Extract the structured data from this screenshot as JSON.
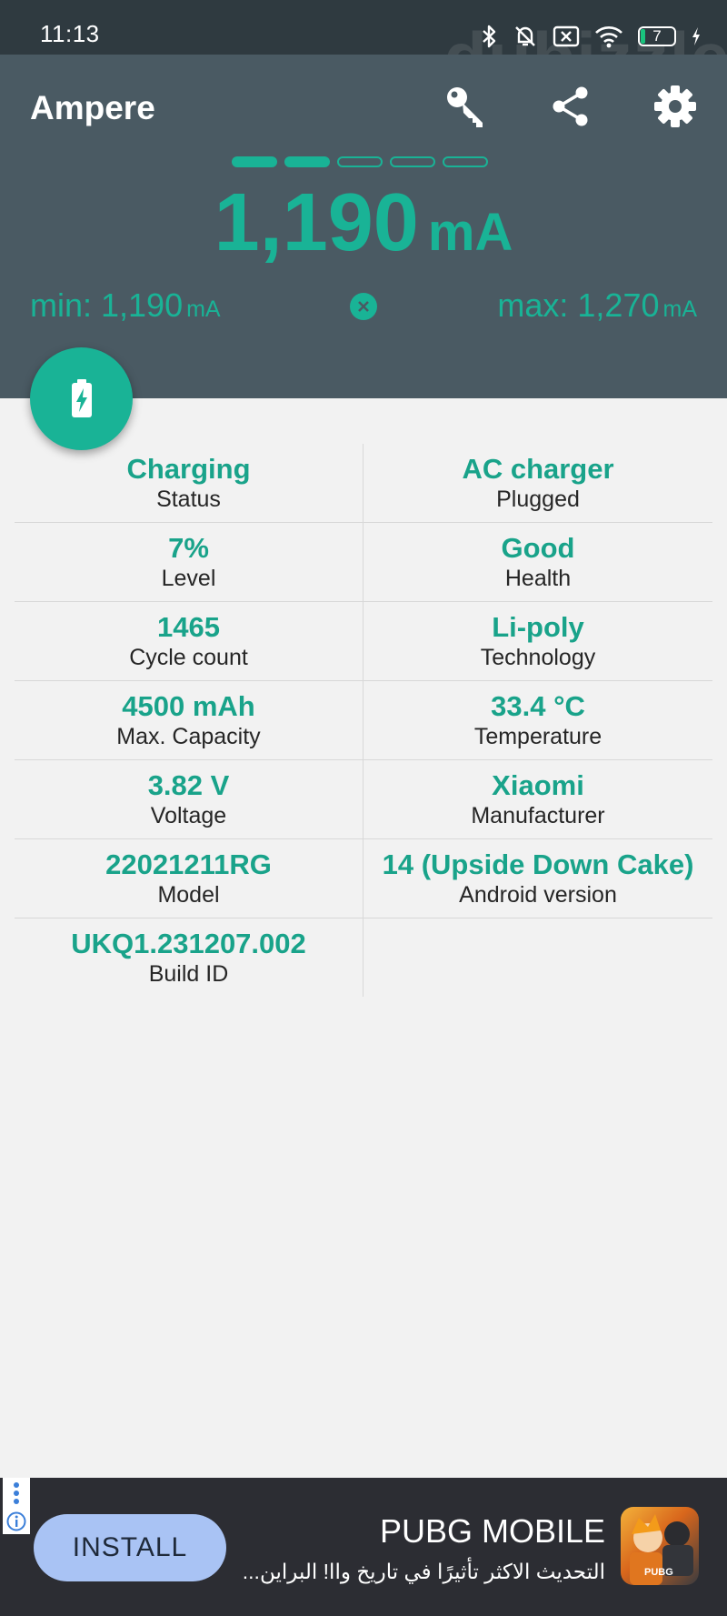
{
  "status_bar": {
    "time": "11:13",
    "battery_level": "7"
  },
  "watermark": "dubizzle",
  "app": {
    "title": "Ampere"
  },
  "meter": {
    "current_value": "1,190",
    "current_unit": "mA",
    "min_label": "min: 1,190",
    "min_unit": "mA",
    "max_label": "max: 1,270",
    "max_unit": "mA",
    "indicator_filled": 2,
    "indicator_total": 5
  },
  "info": {
    "rows": [
      [
        {
          "value": "Charging",
          "label": "Status"
        },
        {
          "value": "AC charger",
          "label": "Plugged"
        }
      ],
      [
        {
          "value": "7%",
          "label": "Level"
        },
        {
          "value": "Good",
          "label": "Health"
        }
      ],
      [
        {
          "value": "1465",
          "label": "Cycle count"
        },
        {
          "value": "Li-poly",
          "label": "Technology"
        }
      ],
      [
        {
          "value": "4500 mAh",
          "label": "Max. Capacity"
        },
        {
          "value": "33.4 °C",
          "label": "Temperature"
        }
      ],
      [
        {
          "value": "3.82 V",
          "label": "Voltage"
        },
        {
          "value": "Xiaomi",
          "label": "Manufacturer"
        }
      ],
      [
        {
          "value": "22021211RG",
          "label": "Model"
        },
        {
          "value": "14 (Upside Down Cake)",
          "label": "Android version"
        }
      ],
      [
        {
          "value": "UKQ1.231207.002",
          "label": "Build ID"
        },
        {
          "value": "",
          "label": ""
        }
      ]
    ]
  },
  "ad": {
    "install_label": "INSTALL",
    "title": "PUBG MOBILE",
    "subtitle": "التحديث الاكثر تأثيرًا في تاريخ واا! البراين...",
    "logo_text": "PUBG"
  },
  "colors": {
    "accent": "#19b396",
    "header": "#4a5a63",
    "status_bar": "#2f3a40",
    "background": "#f2f2f2"
  },
  "icons": [
    "bluetooth-icon",
    "mute-icon",
    "sim-off-icon",
    "wifi-icon",
    "battery-icon",
    "charging-bolt-icon",
    "key-icon",
    "share-icon",
    "settings-icon",
    "reset-icon",
    "battery-charging-icon",
    "ad-info-icon"
  ]
}
